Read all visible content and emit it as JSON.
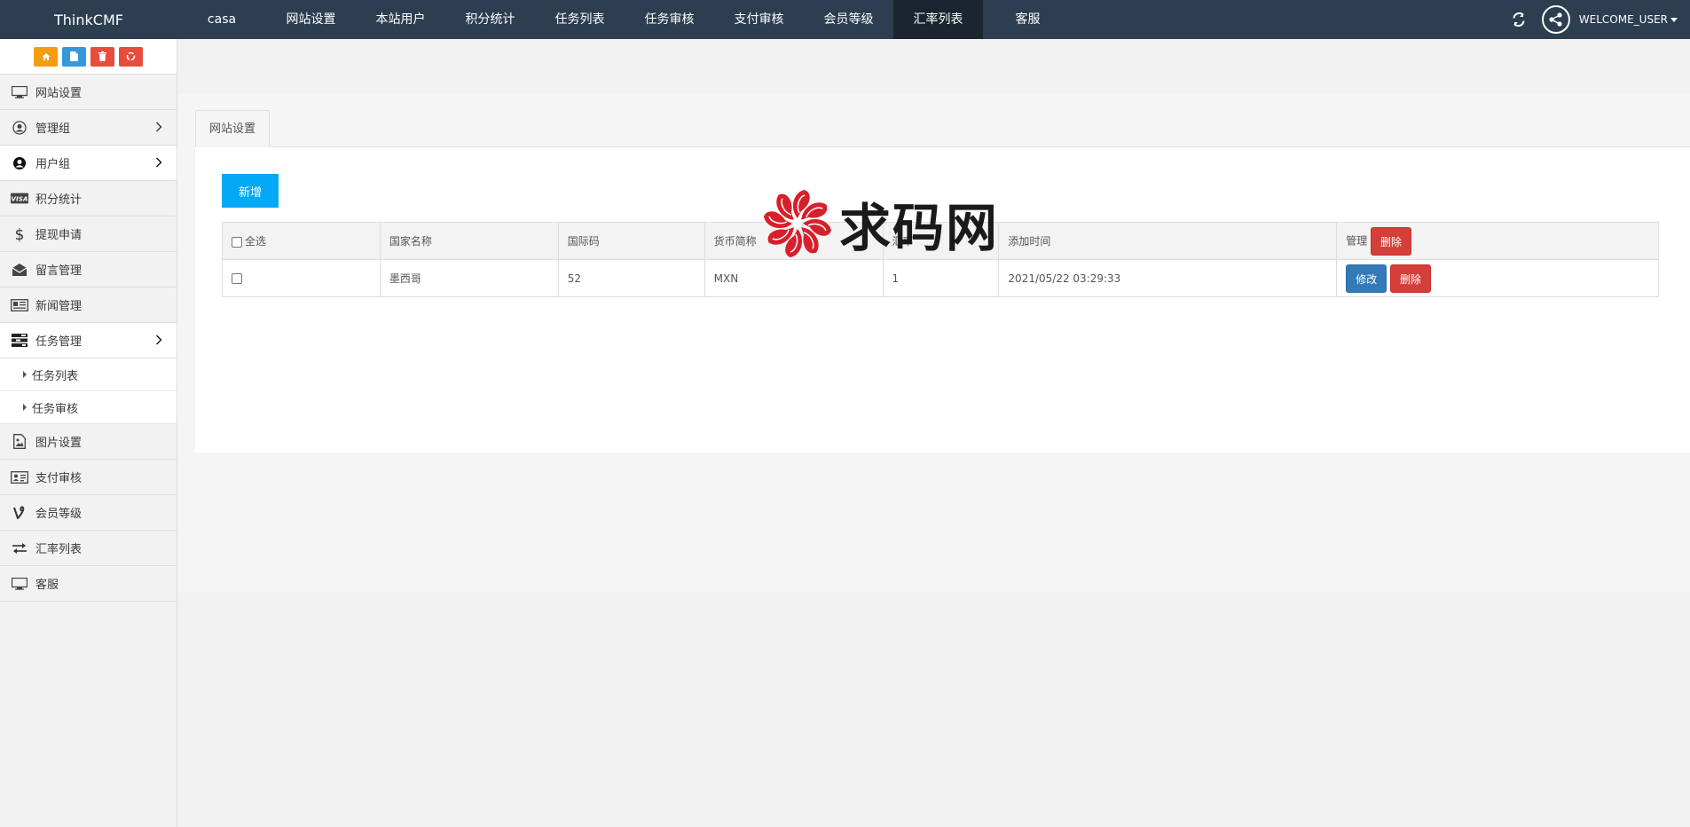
{
  "brand": "ThinkCMF",
  "topnav": [
    {
      "label": "casa",
      "width": 100
    },
    {
      "label": "网站设置",
      "width": 101
    },
    {
      "label": "本站用户",
      "width": 101
    },
    {
      "label": "积分统计",
      "width": 101
    },
    {
      "label": "任务列表",
      "width": 101
    },
    {
      "label": "任务审核",
      "width": 101
    },
    {
      "label": "支付审核",
      "width": 101
    },
    {
      "label": "会员等级",
      "width": 101
    },
    {
      "label": "汇率列表",
      "width": 101
    },
    {
      "label": "客服",
      "width": 101
    }
  ],
  "active_topnav": "汇率列表",
  "user": {
    "welcome": "WELCOME_USER"
  },
  "sidebar": {
    "items": [
      {
        "label": "网站设置"
      },
      {
        "label": "管理组"
      },
      {
        "label": "用户组"
      },
      {
        "label": "积分统计"
      },
      {
        "label": "提现申请"
      },
      {
        "label": "留言管理"
      },
      {
        "label": "新闻管理"
      },
      {
        "label": "任务管理"
      },
      {
        "label": "任务列表"
      },
      {
        "label": "任务审核"
      },
      {
        "label": "图片设置"
      },
      {
        "label": "支付审核"
      },
      {
        "label": "会员等级"
      },
      {
        "label": "汇率列表"
      },
      {
        "label": "客服"
      }
    ]
  },
  "tab": {
    "label": "网站设置"
  },
  "toolbar": {
    "add_label": "新增"
  },
  "table": {
    "headers": {
      "select_all": "全选",
      "country": "国家名称",
      "code": "国际码",
      "currency": "货币简称",
      "rate": "汇率",
      "time": "添加时间",
      "manage": "管理"
    },
    "header_delete_label": "删除",
    "rows": [
      {
        "country": "墨西哥",
        "code": "52",
        "currency": "MXN",
        "rate": "1",
        "time": "2021/05/22 03:29:33",
        "edit_label": "修改",
        "delete_label": "删除"
      }
    ]
  },
  "watermark": {
    "text": "求码网"
  },
  "colors": {
    "topbar": "#2c3e50",
    "add_button": "#03a9f4",
    "danger": "#d43f3a",
    "primary": "#337ab7"
  }
}
